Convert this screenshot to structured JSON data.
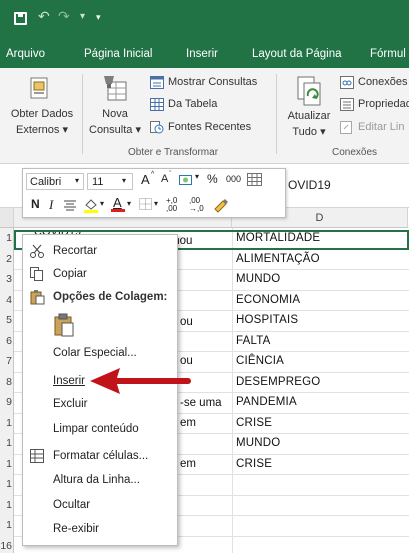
{
  "title_bar": {
    "save_icon": "save-icon",
    "undo_icon": "undo-icon",
    "redo_icon": "redo-icon"
  },
  "tabs": [
    "Arquivo",
    "Página Inicial",
    "Inserir",
    "Layout da Página",
    "Fórmul"
  ],
  "ribbon": {
    "get_data": [
      "Obter Dados",
      "Externos"
    ],
    "new_query": [
      "Nova",
      "Consulta"
    ],
    "show_queries": "Mostrar Consultas",
    "from_table": "Da Tabela",
    "recent_sources": "Fontes Recentes",
    "group_get_transform": "Obter e Transformar",
    "refresh_all": [
      "Atualizar",
      "Tudo"
    ],
    "connections": "Conexões",
    "properties": "Propriedad",
    "edit_links": "Editar Lin",
    "group_connections": "Conexões"
  },
  "formula_bar": {
    "value": "OVID19"
  },
  "mini_toolbar": {
    "font": "Calibri",
    "size": "11",
    "grow": "A",
    "shrink": "A",
    "percent": "%",
    "thousands": "000",
    "bold": "N",
    "italic": "I",
    "dec_inc": "+,0\n,00",
    "dec_dec": ",00\n→,0"
  },
  "columns": {
    "d": "D"
  },
  "row_numbers": [
    "1",
    "2",
    "3",
    "4",
    "5",
    "6",
    "7",
    "8",
    "9",
    "1",
    "1",
    "1",
    "1",
    "1",
    "1",
    "16"
  ],
  "column_c_partial": {
    "r1": "COVID19",
    "r1b": "acasionou",
    "r5": "ou",
    "r7": "ou",
    "r9": "-se uma",
    "r10": "em",
    "r12": "em"
  },
  "column_d": [
    "MORTALIDADE",
    "ALIMENTAÇÃO",
    "MUNDO",
    "ECONOMIA",
    "HOSPITAIS",
    "FALTA",
    "CIÊNCIA",
    "DESEMPREGO",
    "PANDEMIA",
    "CRISE",
    "MUNDO",
    "CRISE"
  ],
  "context_menu": {
    "cut": "Recortar",
    "copy": "Copiar",
    "paste_options": "Opções de Colagem:",
    "paste_special": "Colar Especial...",
    "insert": "Inserir",
    "delete": "Excluir",
    "clear": "Limpar conteúdo",
    "format_cells": "Formatar células...",
    "row_height": "Altura da Linha...",
    "hide": "Ocultar",
    "unhide": "Re-exibir"
  },
  "colors": {
    "excel_green": "#217346",
    "arrow_red": "#c0141a"
  }
}
